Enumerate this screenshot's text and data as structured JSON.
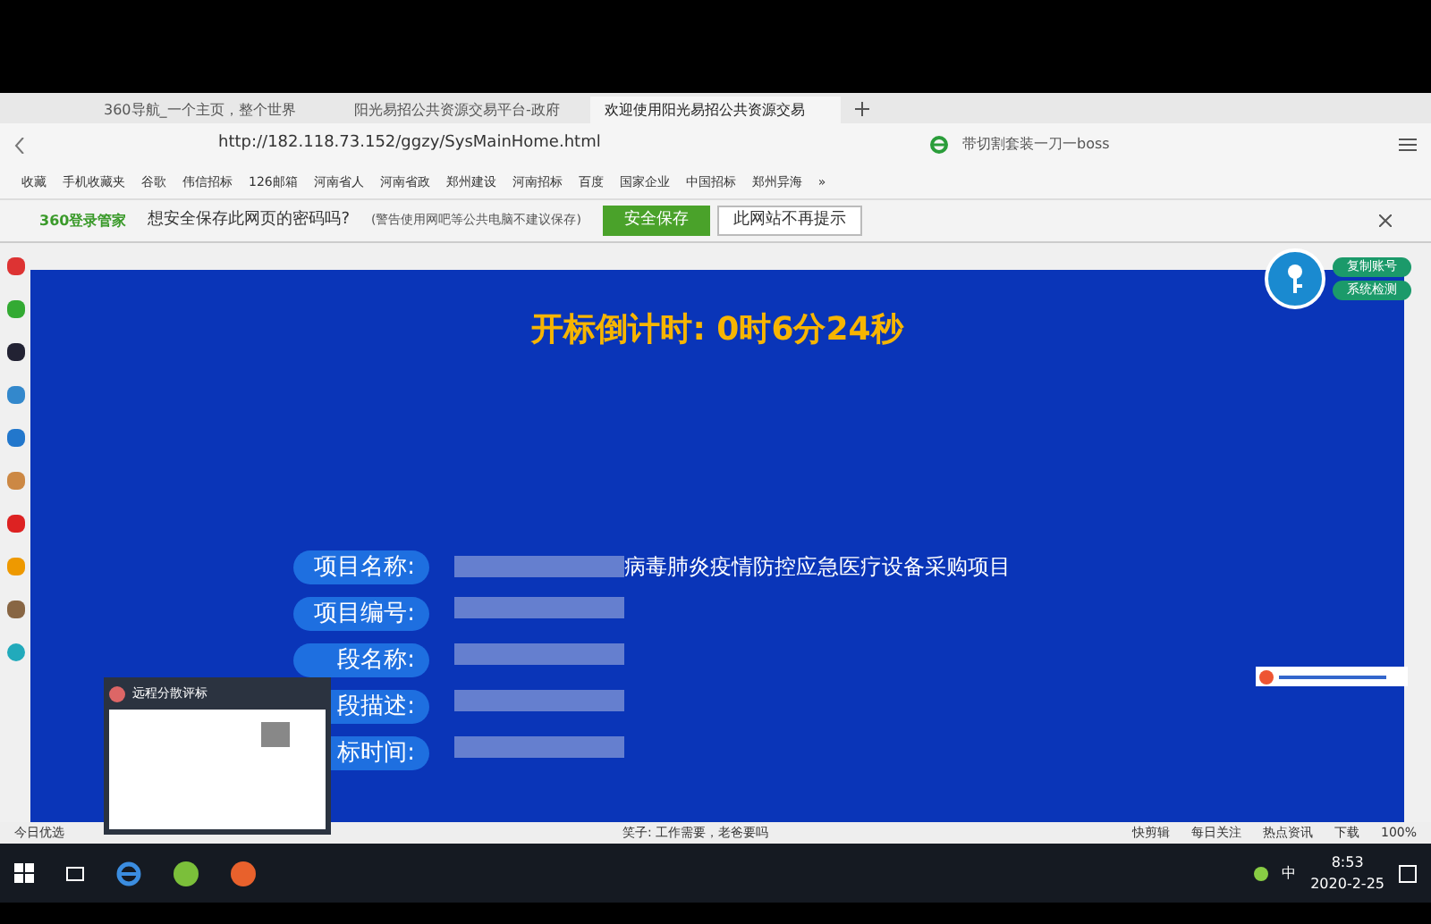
{
  "browser": {
    "tabs": [
      {
        "label": "360导航_一个主页，整个世界",
        "selected": false
      },
      {
        "label": "阳光易招公共资源交易平台-政府",
        "selected": false
      },
      {
        "label": "欢迎使用阳光易招公共资源交易",
        "selected": true
      }
    ],
    "address": "http://182.118.73.152/ggzy/SysMainHome.html",
    "search": "带切割套装一刀一boss",
    "bookmarks": [
      "收藏",
      "手机收藏夹",
      "谷歌",
      "伟信招标",
      "126邮箱",
      "河南省人",
      "河南省政",
      "郑州建设",
      "河南招标",
      "百度",
      "国家企业",
      "中国招标",
      "郑州异海",
      "»"
    ],
    "password_bar": {
      "brand": "360登录管家",
      "question": "想安全保存此网页的密码吗?",
      "warning": "(警告使用网吧等公共电脑不建议保存)",
      "save": "安全保存",
      "never": "此网站不再提示"
    }
  },
  "page": {
    "countdown": "开标倒计时: 0时6分24秒",
    "side_buttons": [
      "复制账号",
      "系统检测"
    ],
    "fields": [
      {
        "label": "项目名称:",
        "value": "病毒肺炎疫情防控应急医疗设备采购项目"
      },
      {
        "label": "项目编号:"
      },
      {
        "label": "段名称:"
      },
      {
        "label": "段描述:"
      },
      {
        "label": "标时间:"
      }
    ]
  },
  "popup": {
    "title": "远程分散评标"
  },
  "status_bar": {
    "left": "今日优选",
    "news": "笑子: 工作需要，老爸要吗",
    "items": [
      "快剪辑",
      "每日关注",
      "热点资讯",
      "下载",
      "100%"
    ]
  },
  "taskbar": {
    "ime": "中",
    "time": "8:53",
    "date": "2020-2-25"
  }
}
